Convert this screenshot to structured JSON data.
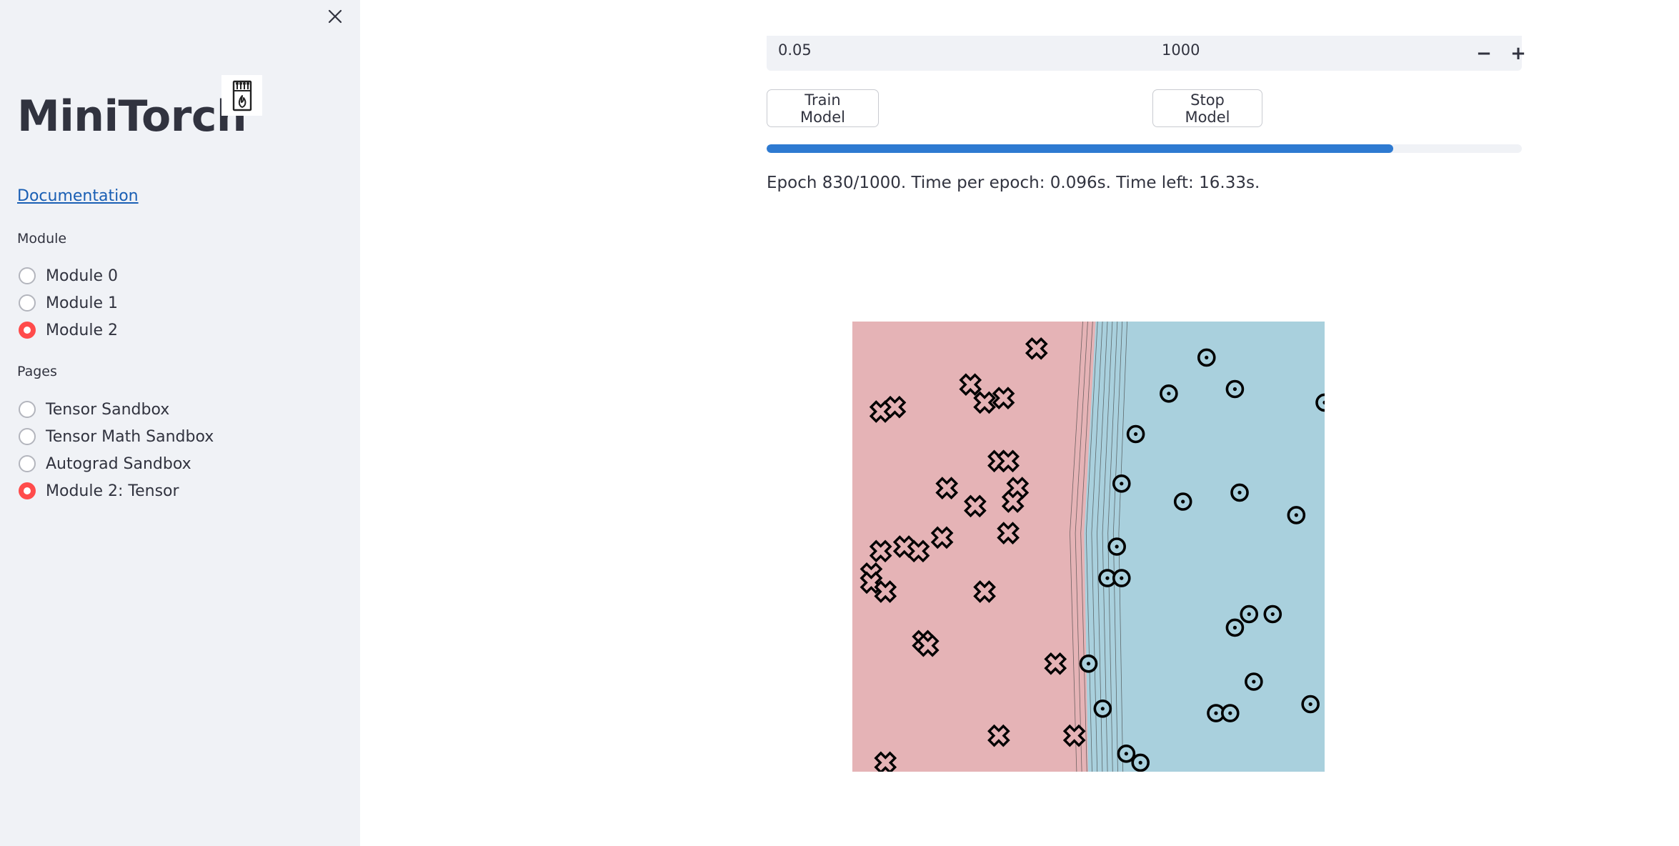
{
  "sidebar": {
    "title": "MiniTorch",
    "logo_icon": "minitorch-matchbox-logo",
    "documentation_link": "Documentation",
    "module_group": {
      "label": "Module",
      "options": [
        "Module 0",
        "Module 1",
        "Module 2"
      ],
      "selected": "Module 2"
    },
    "pages_group": {
      "label": "Pages",
      "options": [
        "Tensor Sandbox",
        "Tensor Math Sandbox",
        "Autograd Sandbox",
        "Module 2: Tensor"
      ],
      "selected": "Module 2: Tensor"
    }
  },
  "controls": {
    "learning_rate_value": "0.05",
    "epochs_value": "1000",
    "minus_label": "−",
    "plus_label": "+",
    "train_button": "Train Model",
    "stop_button": "Stop Model"
  },
  "progress": {
    "fraction": 0.83,
    "status": "Epoch 830/1000. Time per epoch: 0.096s. Time left: 16.33s."
  },
  "colors": {
    "accent_radio": "#ff4b4b",
    "progress_fill": "#2e7ad1",
    "region_class0": "#e5b3b6",
    "region_class1": "#a9d0dd",
    "link": "#1a5fb4"
  },
  "chart_data": {
    "type": "scatter",
    "title": "",
    "xlabel": "",
    "ylabel": "",
    "xlim": [
      0,
      1
    ],
    "ylim": [
      0,
      1
    ],
    "grid": false,
    "legend": "none",
    "decision_boundary_x_top": 0.5,
    "decision_boundary_x_bottom": 0.49,
    "series": [
      {
        "marker": "x",
        "points": [
          [
            0.39,
            0.94
          ],
          [
            0.25,
            0.86
          ],
          [
            0.32,
            0.83
          ],
          [
            0.28,
            0.82
          ],
          [
            0.06,
            0.8
          ],
          [
            0.09,
            0.81
          ],
          [
            0.31,
            0.69
          ],
          [
            0.33,
            0.69
          ],
          [
            0.35,
            0.63
          ],
          [
            0.34,
            0.6
          ],
          [
            0.2,
            0.63
          ],
          [
            0.26,
            0.59
          ],
          [
            0.19,
            0.52
          ],
          [
            0.33,
            0.53
          ],
          [
            0.11,
            0.5
          ],
          [
            0.14,
            0.49
          ],
          [
            0.06,
            0.49
          ],
          [
            0.04,
            0.44
          ],
          [
            0.04,
            0.42
          ],
          [
            0.07,
            0.4
          ],
          [
            0.28,
            0.4
          ],
          [
            0.15,
            0.29
          ],
          [
            0.16,
            0.28
          ],
          [
            0.43,
            0.24
          ],
          [
            0.31,
            0.08
          ],
          [
            0.47,
            0.08
          ],
          [
            0.07,
            0.02
          ]
        ]
      },
      {
        "marker": "o",
        "points": [
          [
            0.75,
            0.92
          ],
          [
            0.67,
            0.84
          ],
          [
            0.81,
            0.85
          ],
          [
            1.0,
            0.82
          ],
          [
            0.6,
            0.75
          ],
          [
            0.57,
            0.64
          ],
          [
            0.7,
            0.6
          ],
          [
            0.82,
            0.62
          ],
          [
            0.94,
            0.57
          ],
          [
            0.56,
            0.5
          ],
          [
            0.54,
            0.43
          ],
          [
            0.57,
            0.43
          ],
          [
            0.84,
            0.35
          ],
          [
            0.81,
            0.32
          ],
          [
            0.89,
            0.35
          ],
          [
            0.5,
            0.24
          ],
          [
            0.85,
            0.2
          ],
          [
            0.97,
            0.15
          ],
          [
            0.53,
            0.14
          ],
          [
            0.77,
            0.13
          ],
          [
            0.8,
            0.13
          ],
          [
            0.58,
            0.04
          ],
          [
            0.61,
            0.02
          ]
        ]
      }
    ]
  }
}
